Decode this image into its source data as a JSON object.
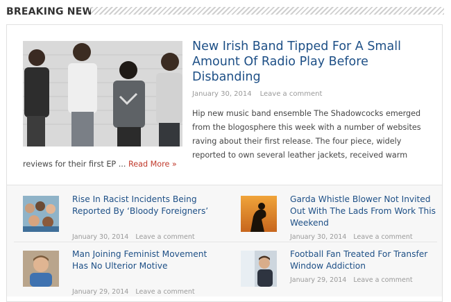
{
  "section": {
    "title": "BREAKING NEWS"
  },
  "featured": {
    "title": "New Irish Band Tipped For A Small Amount Of Radio Play Before Disbanding",
    "date": "January 30, 2014",
    "comments": "Leave a comment",
    "excerpt": "Hip new music band ensemble The Shadowcocks emerged from the blogosphere this week with a number of websites raving about their first release. The four piece, widely reported to own several leather jackets, received warm",
    "excerpt_tail": "reviews for their first EP ...",
    "read_more": "Read More »"
  },
  "items": [
    {
      "title": "Rise In Racist Incidents Being Reported By ‘Bloody Foreigners’",
      "date": "January 30, 2014",
      "comments": "Leave a comment"
    },
    {
      "title": "Garda Whistle Blower Not Invited Out With The Lads From Work This Weekend",
      "date": "January 30, 2014",
      "comments": "Leave a comment"
    },
    {
      "title": "Man Joining Feminist Movement Has No Ulterior Motive",
      "date": "January 29, 2014",
      "comments": "Leave a comment"
    },
    {
      "title": "Football Fan Treated For Transfer Window Addiction",
      "date": "January 29, 2014",
      "comments": "Leave a comment"
    }
  ]
}
